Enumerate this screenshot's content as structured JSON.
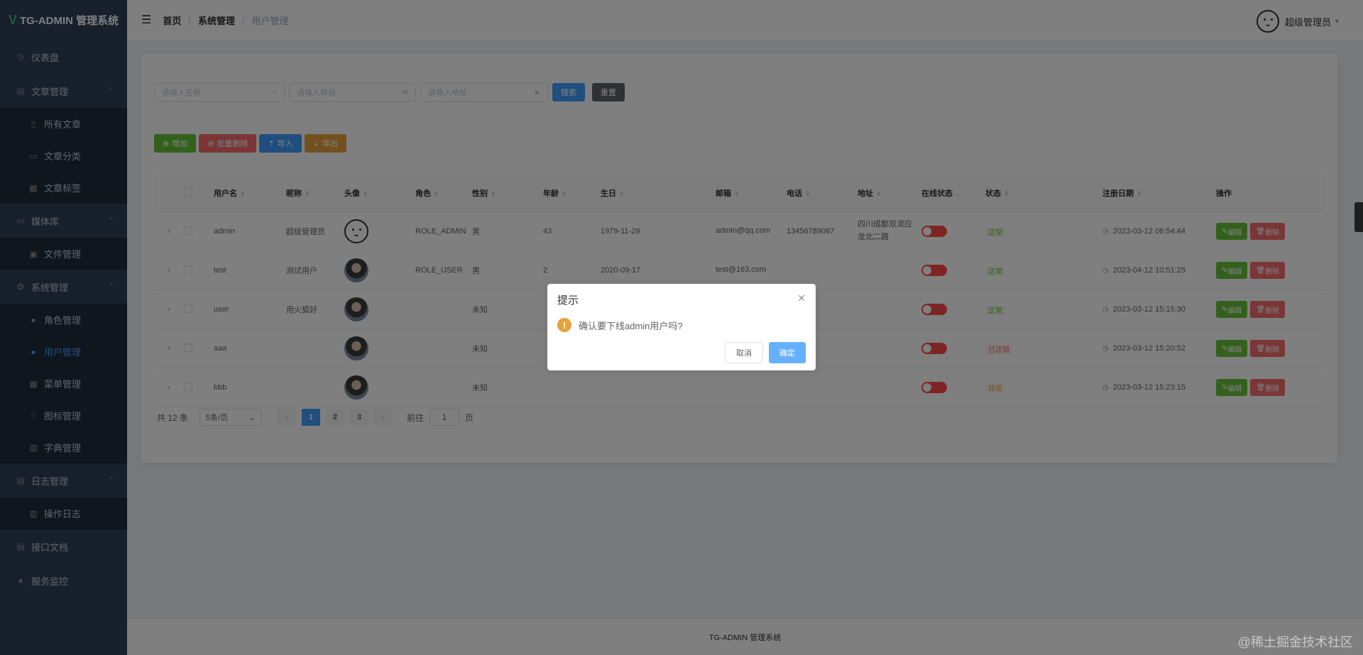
{
  "app": {
    "title": "TG-ADMIN 管理系统",
    "logo_glyph": "V"
  },
  "sidebar": {
    "items": [
      {
        "label": "仪表盘",
        "icon": "dashboard-icon",
        "type": "top"
      },
      {
        "label": "文章管理",
        "icon": "document-icon",
        "type": "group"
      },
      {
        "label": "所有文章",
        "icon": "book-icon",
        "type": "sub"
      },
      {
        "label": "文章分类",
        "icon": "folder-icon",
        "type": "sub"
      },
      {
        "label": "文章标签",
        "icon": "grid-icon",
        "type": "sub"
      },
      {
        "label": "媒体库",
        "icon": "folder-icon",
        "type": "group"
      },
      {
        "label": "文件管理",
        "icon": "image-icon",
        "type": "sub"
      },
      {
        "label": "系统管理",
        "icon": "gear-icon",
        "type": "group"
      },
      {
        "label": "角色管理",
        "icon": "user-icon",
        "type": "sub"
      },
      {
        "label": "用户管理",
        "icon": "user-icon",
        "type": "sub",
        "active": true
      },
      {
        "label": "菜单管理",
        "icon": "grid-icon",
        "type": "sub"
      },
      {
        "label": "图标管理",
        "icon": "star-icon",
        "type": "sub"
      },
      {
        "label": "字典管理",
        "icon": "chart-icon",
        "type": "sub"
      },
      {
        "label": "日志管理",
        "icon": "document-icon",
        "type": "group"
      },
      {
        "label": "操作日志",
        "icon": "chart-icon",
        "type": "sub"
      },
      {
        "label": "接口文档",
        "icon": "document-icon",
        "type": "top"
      },
      {
        "label": "服务监控",
        "icon": "bell-icon",
        "type": "top"
      }
    ]
  },
  "header": {
    "breadcrumb": [
      "首页",
      "系统管理",
      "用户管理"
    ],
    "username": "超级管理员"
  },
  "search": {
    "name_placeholder": "请输入名称",
    "email_placeholder": "请输入邮箱",
    "address_placeholder": "请输入地址",
    "search_label": "搜索",
    "reset_label": "重置"
  },
  "toolbar": {
    "add_label": "增加",
    "batch_delete_label": "批量删除",
    "import_label": "导入",
    "export_label": "导出"
  },
  "table": {
    "columns": [
      "用户名",
      "昵称",
      "头像",
      "角色",
      "性别",
      "年龄",
      "生日",
      "邮箱",
      "电话",
      "地址",
      "在线状态",
      "状态",
      "注册日期",
      "操作"
    ],
    "edit_label": "编辑",
    "delete_label": "删除",
    "rows": [
      {
        "username": "admin",
        "nickname": "超级管理员",
        "avatar": "face",
        "role": "ROLE_ADMIN",
        "gender": "男",
        "age": "43",
        "birthday": "1979-11-29",
        "email": "admin@qq.com",
        "phone": "13456789087",
        "address": "四川成都双流应龙北二路",
        "online": false,
        "status": "正常",
        "status_type": "ok",
        "date": "2023-03-12 06:54:44"
      },
      {
        "username": "test",
        "nickname": "测试用户",
        "avatar": "photo",
        "role": "ROLE_USER",
        "gender": "男",
        "age": "2",
        "birthday": "2020-09-17",
        "email": "test@163.com",
        "phone": "",
        "address": "",
        "online": false,
        "status": "正常",
        "status_type": "ok",
        "date": "2023-04-12 10:51:25"
      },
      {
        "username": "user",
        "nickname": "用火狐好",
        "avatar": "photo",
        "role": "",
        "gender": "未知",
        "age": "",
        "birthday": "",
        "email": "",
        "phone": "",
        "address": "",
        "online": false,
        "status": "正常",
        "status_type": "ok",
        "date": "2023-03-12 15:15:30"
      },
      {
        "username": "aaa",
        "nickname": "",
        "avatar": "photo",
        "role": "",
        "gender": "未知",
        "age": "",
        "birthday": "",
        "email": "",
        "phone": "",
        "address": "",
        "online": false,
        "status": "已注销",
        "status_type": "off",
        "date": "2023-03-12 15:20:52"
      },
      {
        "username": "bbb",
        "nickname": "",
        "avatar": "photo",
        "role": "",
        "gender": "未知",
        "age": "",
        "birthday": "",
        "email": "",
        "phone": "",
        "address": "",
        "online": false,
        "status": "异常",
        "status_type": "warn",
        "date": "2023-03-12 15:23:15"
      }
    ]
  },
  "pagination": {
    "total": "共 12 条",
    "page_size": "5条/页",
    "pages": [
      "1",
      "2",
      "3"
    ],
    "current": "1",
    "goto_prefix": "前往",
    "goto_value": "1",
    "goto_suffix": "页"
  },
  "footer": {
    "text": "TG-ADMIN 管理系统"
  },
  "dialog": {
    "title": "提示",
    "message": "确认要下线admin用户吗?",
    "cancel_label": "取消",
    "confirm_label": "确定"
  },
  "watermark": "@稀土掘金技术社区",
  "colors": {
    "primary": "#409eff",
    "success": "#67c23a",
    "danger": "#f56c6c",
    "warning": "#e6a23c",
    "sidebar": "#304156"
  }
}
